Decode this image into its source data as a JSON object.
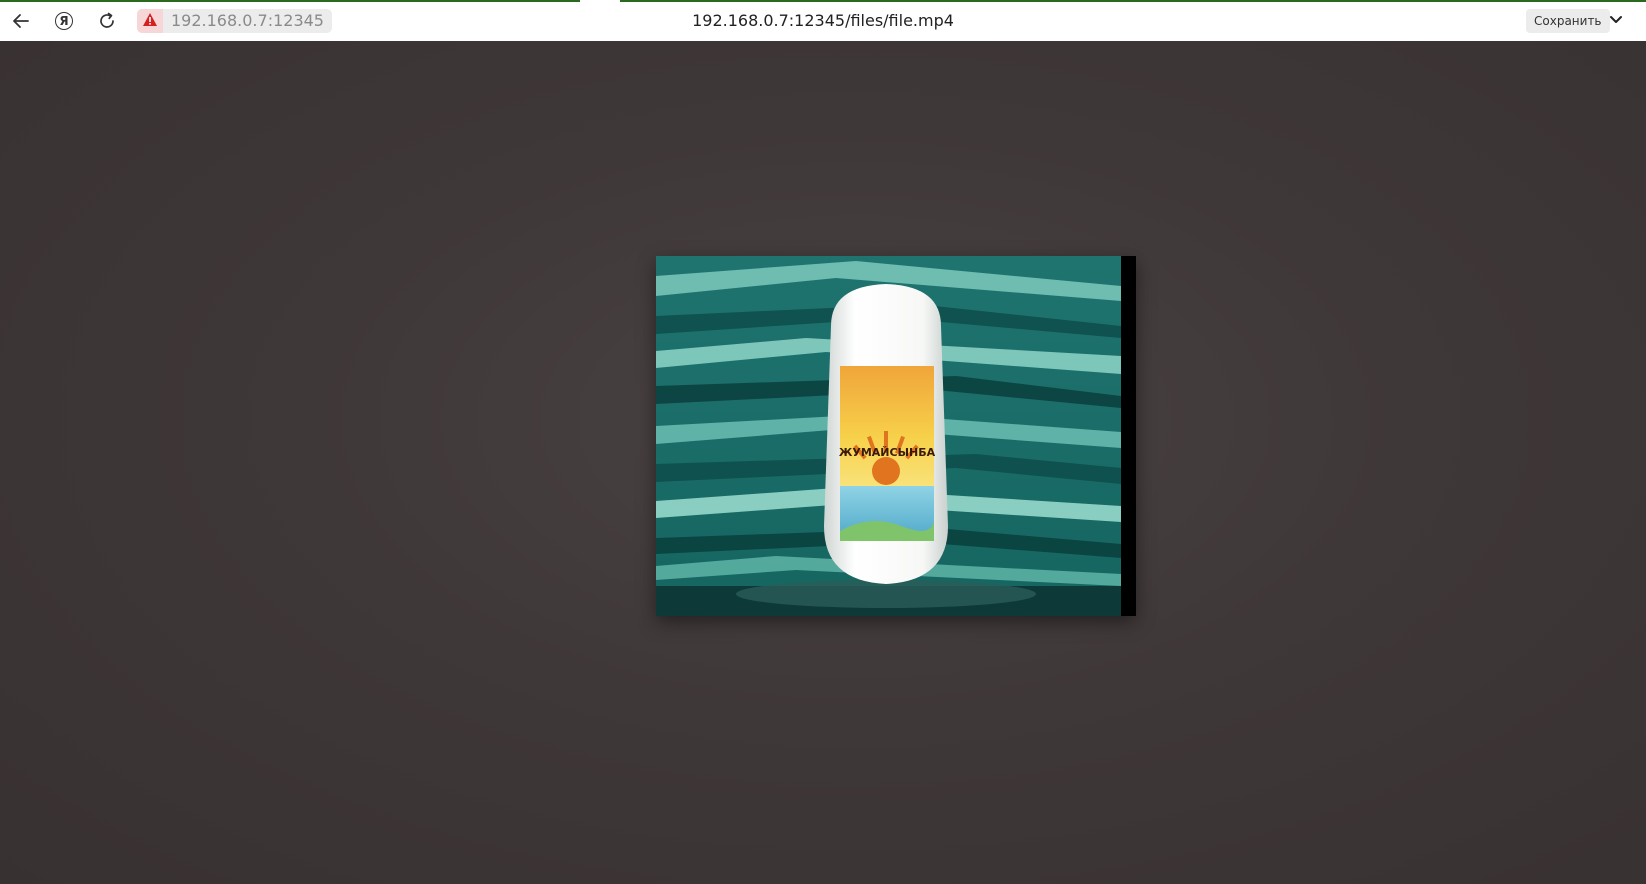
{
  "browser": {
    "address_host": "192.168.0.7:12345",
    "page_title": "192.168.0.7:12345/files/file.mp4",
    "save_label": "Сохранить",
    "icons": {
      "back": "arrow-left-icon",
      "yandex": "yandex-logo-icon",
      "reload": "reload-icon",
      "warning": "warning-triangle-icon",
      "menu": "chevron-down-icon"
    }
  },
  "video": {
    "product_label": "ЖУМАЙСЫНБА",
    "colors": {
      "stripes_dark": "#0d4d4a",
      "stripes_light": "#7ec9bd",
      "bottle": "#f4f6f4",
      "label_top": "#f5c33a",
      "label_bottom": "#6fc0d8"
    }
  },
  "colors": {
    "page_background": "#3d3535",
    "toolbar_background": "#ffffff",
    "warning": "#d32020",
    "progress_accent": "#2a6a1f"
  }
}
